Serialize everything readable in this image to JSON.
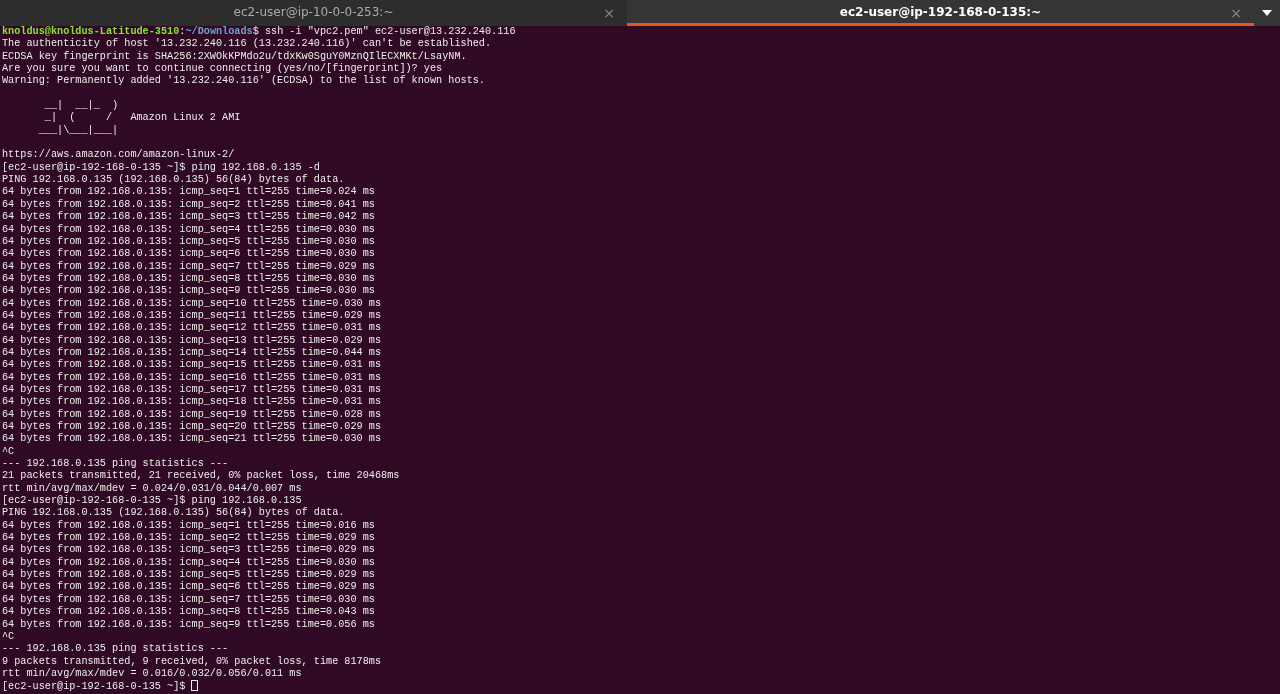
{
  "tabs": [
    {
      "title": "ec2-user@ip-10-0-0-253:~",
      "selected": false,
      "close": "×"
    },
    {
      "title": "ec2-user@ip-192-168-0-135:~",
      "selected": true,
      "close": "×"
    }
  ],
  "lines": [
    {
      "kind": "local_prompt",
      "user": "knoldus@knoldus-Latitude-3510",
      "sep": ":",
      "path": "~/Downloads",
      "command": "$ ssh -i \"vpc2.pem\" ec2-user@13.232.240.116"
    },
    {
      "kind": "text",
      "text": "The authenticity of host '13.232.240.116 (13.232.240.116)' can't be established."
    },
    {
      "kind": "text",
      "text": "ECDSA key fingerprint is SHA256:2XWOkKPMdo2u/tdxKw0SguY0MznQIlECXMKt/LsayNM."
    },
    {
      "kind": "text",
      "text": "Are you sure you want to continue connecting (yes/no/[fingerprint])? yes"
    },
    {
      "kind": "text",
      "text": "Warning: Permanently added '13.232.240.116' (ECDSA) to the list of known hosts."
    },
    {
      "kind": "blank"
    },
    {
      "kind": "text",
      "text": "       __|  __|_  )"
    },
    {
      "kind": "text",
      "text": "       _|  (     /   Amazon Linux 2 AMI"
    },
    {
      "kind": "text",
      "text": "      ___|\\___|___|"
    },
    {
      "kind": "blank"
    },
    {
      "kind": "text",
      "text": "https://aws.amazon.com/amazon-linux-2/"
    },
    {
      "kind": "text",
      "text": "[ec2-user@ip-192-168-0-135 ~]$ ping 192.168.0.135 -d"
    },
    {
      "kind": "text",
      "text": "PING 192.168.0.135 (192.168.0.135) 56(84) bytes of data."
    },
    {
      "kind": "text",
      "text": "64 bytes from 192.168.0.135: icmp_seq=1 ttl=255 time=0.024 ms"
    },
    {
      "kind": "text",
      "text": "64 bytes from 192.168.0.135: icmp_seq=2 ttl=255 time=0.041 ms"
    },
    {
      "kind": "text",
      "text": "64 bytes from 192.168.0.135: icmp_seq=3 ttl=255 time=0.042 ms"
    },
    {
      "kind": "text",
      "text": "64 bytes from 192.168.0.135: icmp_seq=4 ttl=255 time=0.030 ms"
    },
    {
      "kind": "text",
      "text": "64 bytes from 192.168.0.135: icmp_seq=5 ttl=255 time=0.030 ms"
    },
    {
      "kind": "text",
      "text": "64 bytes from 192.168.0.135: icmp_seq=6 ttl=255 time=0.030 ms"
    },
    {
      "kind": "text",
      "text": "64 bytes from 192.168.0.135: icmp_seq=7 ttl=255 time=0.029 ms"
    },
    {
      "kind": "text",
      "text": "64 bytes from 192.168.0.135: icmp_seq=8 ttl=255 time=0.030 ms"
    },
    {
      "kind": "text",
      "text": "64 bytes from 192.168.0.135: icmp_seq=9 ttl=255 time=0.030 ms"
    },
    {
      "kind": "text",
      "text": "64 bytes from 192.168.0.135: icmp_seq=10 ttl=255 time=0.030 ms"
    },
    {
      "kind": "text",
      "text": "64 bytes from 192.168.0.135: icmp_seq=11 ttl=255 time=0.029 ms"
    },
    {
      "kind": "text",
      "text": "64 bytes from 192.168.0.135: icmp_seq=12 ttl=255 time=0.031 ms"
    },
    {
      "kind": "text",
      "text": "64 bytes from 192.168.0.135: icmp_seq=13 ttl=255 time=0.029 ms"
    },
    {
      "kind": "text",
      "text": "64 bytes from 192.168.0.135: icmp_seq=14 ttl=255 time=0.044 ms"
    },
    {
      "kind": "text",
      "text": "64 bytes from 192.168.0.135: icmp_seq=15 ttl=255 time=0.031 ms"
    },
    {
      "kind": "text",
      "text": "64 bytes from 192.168.0.135: icmp_seq=16 ttl=255 time=0.031 ms"
    },
    {
      "kind": "text",
      "text": "64 bytes from 192.168.0.135: icmp_seq=17 ttl=255 time=0.031 ms"
    },
    {
      "kind": "text",
      "text": "64 bytes from 192.168.0.135: icmp_seq=18 ttl=255 time=0.031 ms"
    },
    {
      "kind": "text",
      "text": "64 bytes from 192.168.0.135: icmp_seq=19 ttl=255 time=0.028 ms"
    },
    {
      "kind": "text",
      "text": "64 bytes from 192.168.0.135: icmp_seq=20 ttl=255 time=0.029 ms"
    },
    {
      "kind": "text",
      "text": "64 bytes from 192.168.0.135: icmp_seq=21 ttl=255 time=0.030 ms"
    },
    {
      "kind": "text",
      "text": "^C"
    },
    {
      "kind": "text",
      "text": "--- 192.168.0.135 ping statistics ---"
    },
    {
      "kind": "text",
      "text": "21 packets transmitted, 21 received, 0% packet loss, time 20468ms"
    },
    {
      "kind": "text",
      "text": "rtt min/avg/max/mdev = 0.024/0.031/0.044/0.007 ms"
    },
    {
      "kind": "text",
      "text": "[ec2-user@ip-192-168-0-135 ~]$ ping 192.168.0.135"
    },
    {
      "kind": "text",
      "text": "PING 192.168.0.135 (192.168.0.135) 56(84) bytes of data."
    },
    {
      "kind": "text",
      "text": "64 bytes from 192.168.0.135: icmp_seq=1 ttl=255 time=0.016 ms"
    },
    {
      "kind": "text",
      "text": "64 bytes from 192.168.0.135: icmp_seq=2 ttl=255 time=0.029 ms"
    },
    {
      "kind": "text",
      "text": "64 bytes from 192.168.0.135: icmp_seq=3 ttl=255 time=0.029 ms"
    },
    {
      "kind": "text",
      "text": "64 bytes from 192.168.0.135: icmp_seq=4 ttl=255 time=0.030 ms"
    },
    {
      "kind": "text",
      "text": "64 bytes from 192.168.0.135: icmp_seq=5 ttl=255 time=0.029 ms"
    },
    {
      "kind": "text",
      "text": "64 bytes from 192.168.0.135: icmp_seq=6 ttl=255 time=0.029 ms"
    },
    {
      "kind": "text",
      "text": "64 bytes from 192.168.0.135: icmp_seq=7 ttl=255 time=0.030 ms"
    },
    {
      "kind": "text",
      "text": "64 bytes from 192.168.0.135: icmp_seq=8 ttl=255 time=0.043 ms"
    },
    {
      "kind": "text",
      "text": "64 bytes from 192.168.0.135: icmp_seq=9 ttl=255 time=0.056 ms"
    },
    {
      "kind": "text",
      "text": "^C"
    },
    {
      "kind": "text",
      "text": "--- 192.168.0.135 ping statistics ---"
    },
    {
      "kind": "text",
      "text": "9 packets transmitted, 9 received, 0% packet loss, time 8178ms"
    },
    {
      "kind": "text",
      "text": "rtt min/avg/max/mdev = 0.016/0.032/0.056/0.011 ms"
    },
    {
      "kind": "text",
      "text": "[ec2-user@ip-192-168-0-135 ~]$",
      "cursor": true
    }
  ]
}
